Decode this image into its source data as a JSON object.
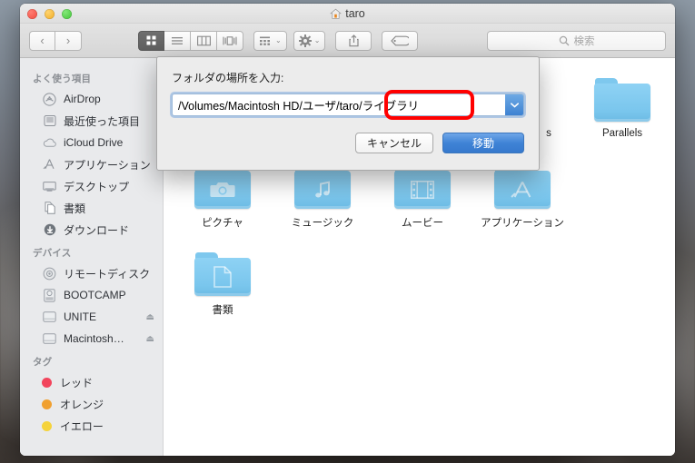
{
  "window": {
    "title": "taro",
    "title_icon": "home-icon",
    "traffic_lights": [
      "close-red",
      "minimize-yellow",
      "zoom-green"
    ]
  },
  "toolbar": {
    "back_glyph": "‹",
    "forward_glyph": "›",
    "view_modes": [
      {
        "name": "icon-view",
        "active": true
      },
      {
        "name": "list-view",
        "active": false
      },
      {
        "name": "column-view",
        "active": false
      },
      {
        "name": "coverflow-view",
        "active": false
      }
    ],
    "arrange_label": "arrange-icon",
    "action_label": "gear-icon",
    "share_label": "share-icon",
    "tag_label": "tag-icon",
    "chevron": "⌄",
    "search_placeholder": "検索"
  },
  "sidebar": {
    "sections": [
      {
        "header": "よく使う項目",
        "items": [
          {
            "label": "AirDrop",
            "icon": "airdrop-icon",
            "eject": false
          },
          {
            "label": "最近使った項目",
            "icon": "recents-icon",
            "eject": false
          },
          {
            "label": "iCloud Drive",
            "icon": "icloud-icon",
            "eject": false
          },
          {
            "label": "アプリケーション",
            "icon": "applications-icon",
            "eject": false
          },
          {
            "label": "デスクトップ",
            "icon": "desktop-icon",
            "eject": false
          },
          {
            "label": "書類",
            "icon": "documents-icon",
            "eject": false
          },
          {
            "label": "ダウンロード",
            "icon": "downloads-icon",
            "eject": false
          }
        ]
      },
      {
        "header": "デバイス",
        "items": [
          {
            "label": "リモートディスク",
            "icon": "remote-disc-icon",
            "eject": false
          },
          {
            "label": "BOOTCAMP",
            "icon": "bootcamp-drive-icon",
            "eject": false
          },
          {
            "label": "UNITE",
            "icon": "hard-drive-icon",
            "eject": true
          },
          {
            "label": "Macintosh…",
            "icon": "hard-drive-icon",
            "eject": true
          }
        ]
      },
      {
        "header": "タグ",
        "items": [
          {
            "label": "レッド",
            "icon": "tag-dot-icon",
            "color": "#f2445c"
          },
          {
            "label": "オレンジ",
            "icon": "tag-dot-icon",
            "color": "#f0a030"
          },
          {
            "label": "イエロー",
            "icon": "tag-dot-icon",
            "color": "#f5d33b"
          }
        ]
      }
    ],
    "eject_glyph": "⏏"
  },
  "content": {
    "rows": [
      [
        {
          "label": "",
          "glyph": "",
          "hidden": true
        },
        {
          "label": "",
          "glyph": "",
          "hidden": true
        },
        {
          "label": "",
          "glyph": "",
          "hidden": true
        },
        {
          "label": "",
          "glyph": "",
          "hidden": true
        },
        {
          "label": "Parallels",
          "glyph": "plain-folder-icon",
          "hidden": false
        }
      ],
      [
        {
          "label": "ピクチャ",
          "glyph": "camera-icon",
          "hidden": false
        },
        {
          "label": "ミュージック",
          "glyph": "music-note-icon",
          "hidden": false
        },
        {
          "label": "ムービー",
          "glyph": "film-icon",
          "hidden": false
        },
        {
          "label": "アプリケーション",
          "glyph": "appstore-a-icon",
          "hidden": false
        }
      ],
      [
        {
          "label": "書類",
          "glyph": "document-page-icon",
          "hidden": false
        }
      ]
    ],
    "occluded_label_fragment": "s"
  },
  "dialog": {
    "label": "フォルダの場所を入力:",
    "path_value": "/Volumes/Macintosh HD/ユーザ/taro/ライブラリ",
    "path_placeholder": "",
    "dropdown_glyph": "▼",
    "cancel_label": "キャンセル",
    "go_label": "移動",
    "highlight_text": "/ライブラリ",
    "highlight_color": "#ff0000"
  }
}
